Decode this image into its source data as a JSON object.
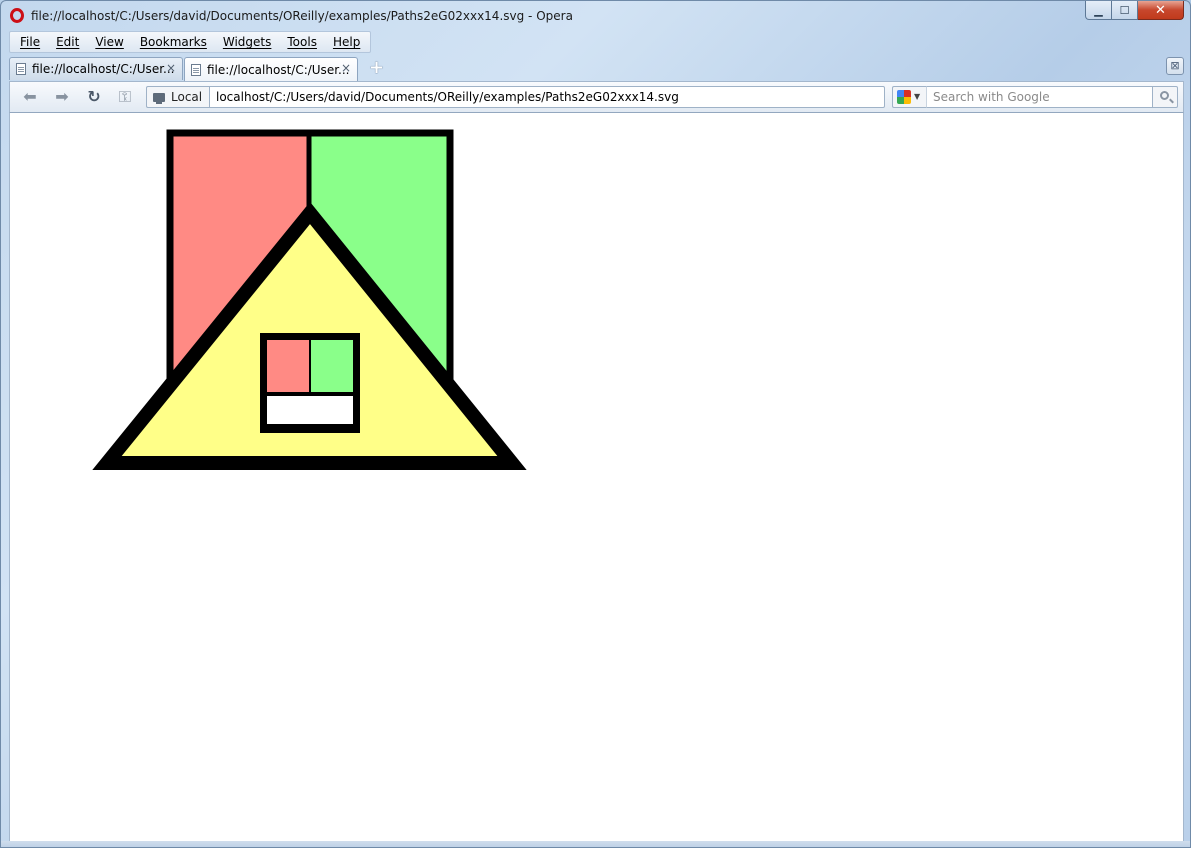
{
  "window": {
    "title": "file://localhost/C:/Users/david/Documents/OReilly/examples/Paths2eG02xxx14.svg - Opera",
    "controls": {
      "minimize": "▁",
      "maximize": "☐",
      "close": "✕"
    }
  },
  "menu": [
    {
      "label": "File"
    },
    {
      "label": "Edit"
    },
    {
      "label": "View"
    },
    {
      "label": "Bookmarks"
    },
    {
      "label": "Widgets"
    },
    {
      "label": "Tools"
    },
    {
      "label": "Help"
    }
  ],
  "tabs": [
    {
      "label": "file://localhost/C:/User...",
      "active": false
    },
    {
      "label": "file://localhost/C:/User...",
      "active": true
    }
  ],
  "tab_close_glyph": "×",
  "new_tab_glyph": "+",
  "trash_glyph": "⊠",
  "nav": {
    "back_glyph": "⬅",
    "forward_glyph": "➡",
    "reload_glyph": "↻",
    "key_glyph": "⚿",
    "site_label": "Local",
    "address": "localhost/C:/Users/david/Documents/OReilly/examples/Paths2eG02xxx14.svg",
    "search_placeholder": "Search with Google"
  },
  "drawing": {
    "colors": {
      "left_panel": "#ff8a84",
      "right_panel": "#8aff8a",
      "triangle": "#ffff88",
      "window_left": "#ff8a84",
      "window_right": "#8aff8a",
      "window_bottom": "#ffffff",
      "stroke": "#000000"
    }
  }
}
